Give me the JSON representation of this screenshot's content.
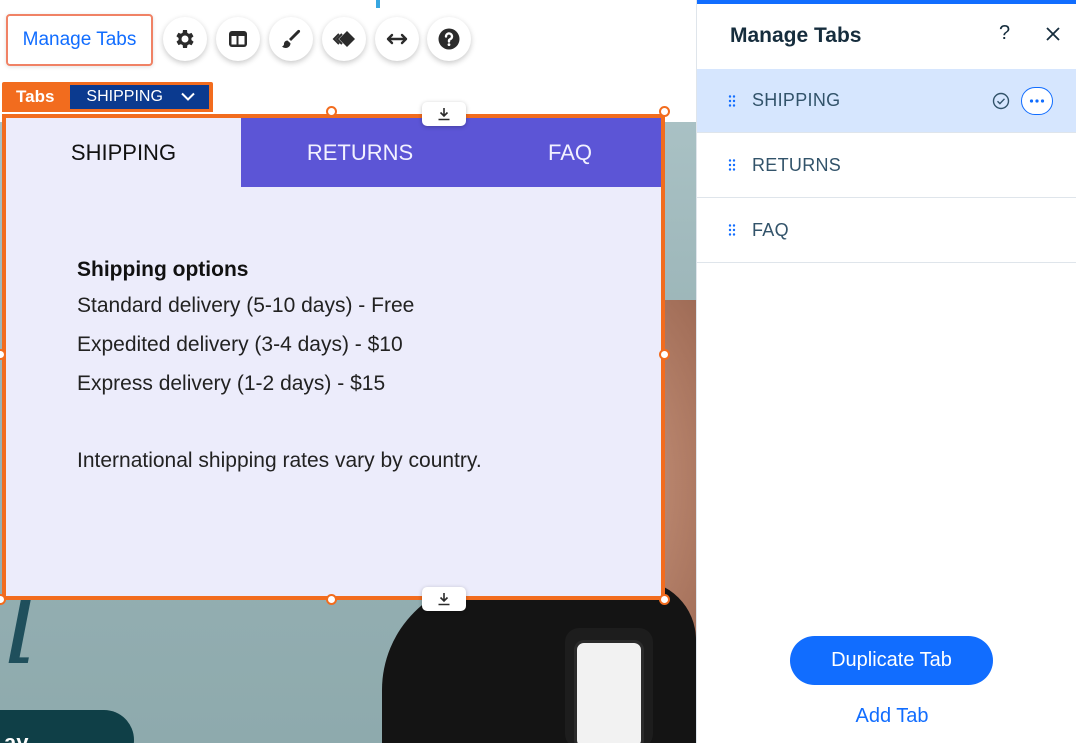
{
  "toolbar": {
    "manage_tabs_label": "Manage Tabs",
    "icons": [
      "gear-icon",
      "layout-icon",
      "brush-icon",
      "animation-icon",
      "stretch-icon",
      "help-icon"
    ]
  },
  "component": {
    "type_label": "Tabs",
    "state_label": "SHIPPING"
  },
  "tabs_widget": {
    "tabs": [
      {
        "label": "SHIPPING",
        "active": true
      },
      {
        "label": "RETURNS",
        "active": false
      },
      {
        "label": "FAQ",
        "active": false
      }
    ],
    "content": {
      "heading": "Shipping options",
      "lines": [
        "Standard delivery (5-10 days) - Free",
        "Expedited delivery (3-4 days) - $10",
        "Express delivery (1-2 days) - $15"
      ],
      "note": "International shipping rates vary by country."
    },
    "colors": {
      "tab_bar": "#5c55d6",
      "content_bg": "#ececfb",
      "selection": "#f26c1e"
    }
  },
  "background": {
    "script_letter": "l",
    "button_text": "ay"
  },
  "panel": {
    "title": "Manage Tabs",
    "help_label": "?",
    "items": [
      {
        "label": "SHIPPING",
        "selected": true
      },
      {
        "label": "RETURNS",
        "selected": false
      },
      {
        "label": "FAQ",
        "selected": false
      }
    ],
    "duplicate_label": "Duplicate Tab",
    "add_label": "Add Tab",
    "colors": {
      "accent": "#116dff",
      "selected_row": "#d6e6fe"
    }
  }
}
